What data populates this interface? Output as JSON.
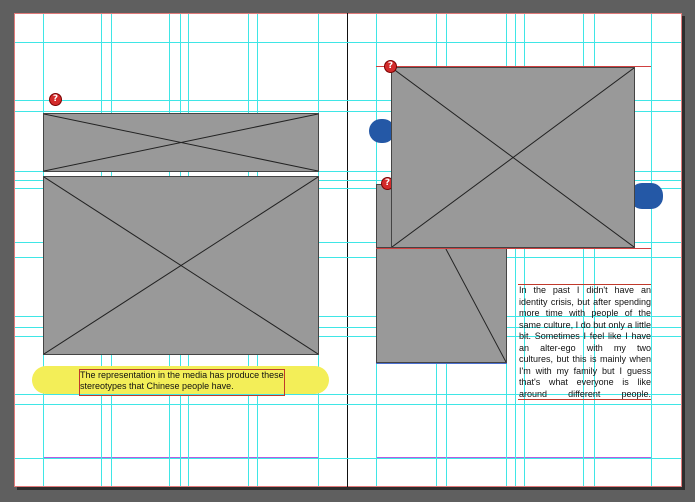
{
  "document": {
    "caption_text": "The representation in the media has produce these stereotypes that Chinese people have.",
    "body_text": "In the past I didn't have an identity crisis, but after spending more time with people of the same culture, I do but only a little bit. Sometimes I feel like I have an alter-ego with my two cultures, but this is mainly when I'm with my family but I guess that's what everyone is like around different people."
  },
  "colors": {
    "pasteboard": "#5f5f5f",
    "guide": "#3fe6e6",
    "margin": "#b55ee0",
    "placeholder": "#999999",
    "highlight": "#f3ee58",
    "warning": "#d32b2b",
    "tab": "#2458a6"
  },
  "icons": {
    "warning": "question-mark-warning-icon",
    "placeholder": "empty-image-frame-x"
  }
}
